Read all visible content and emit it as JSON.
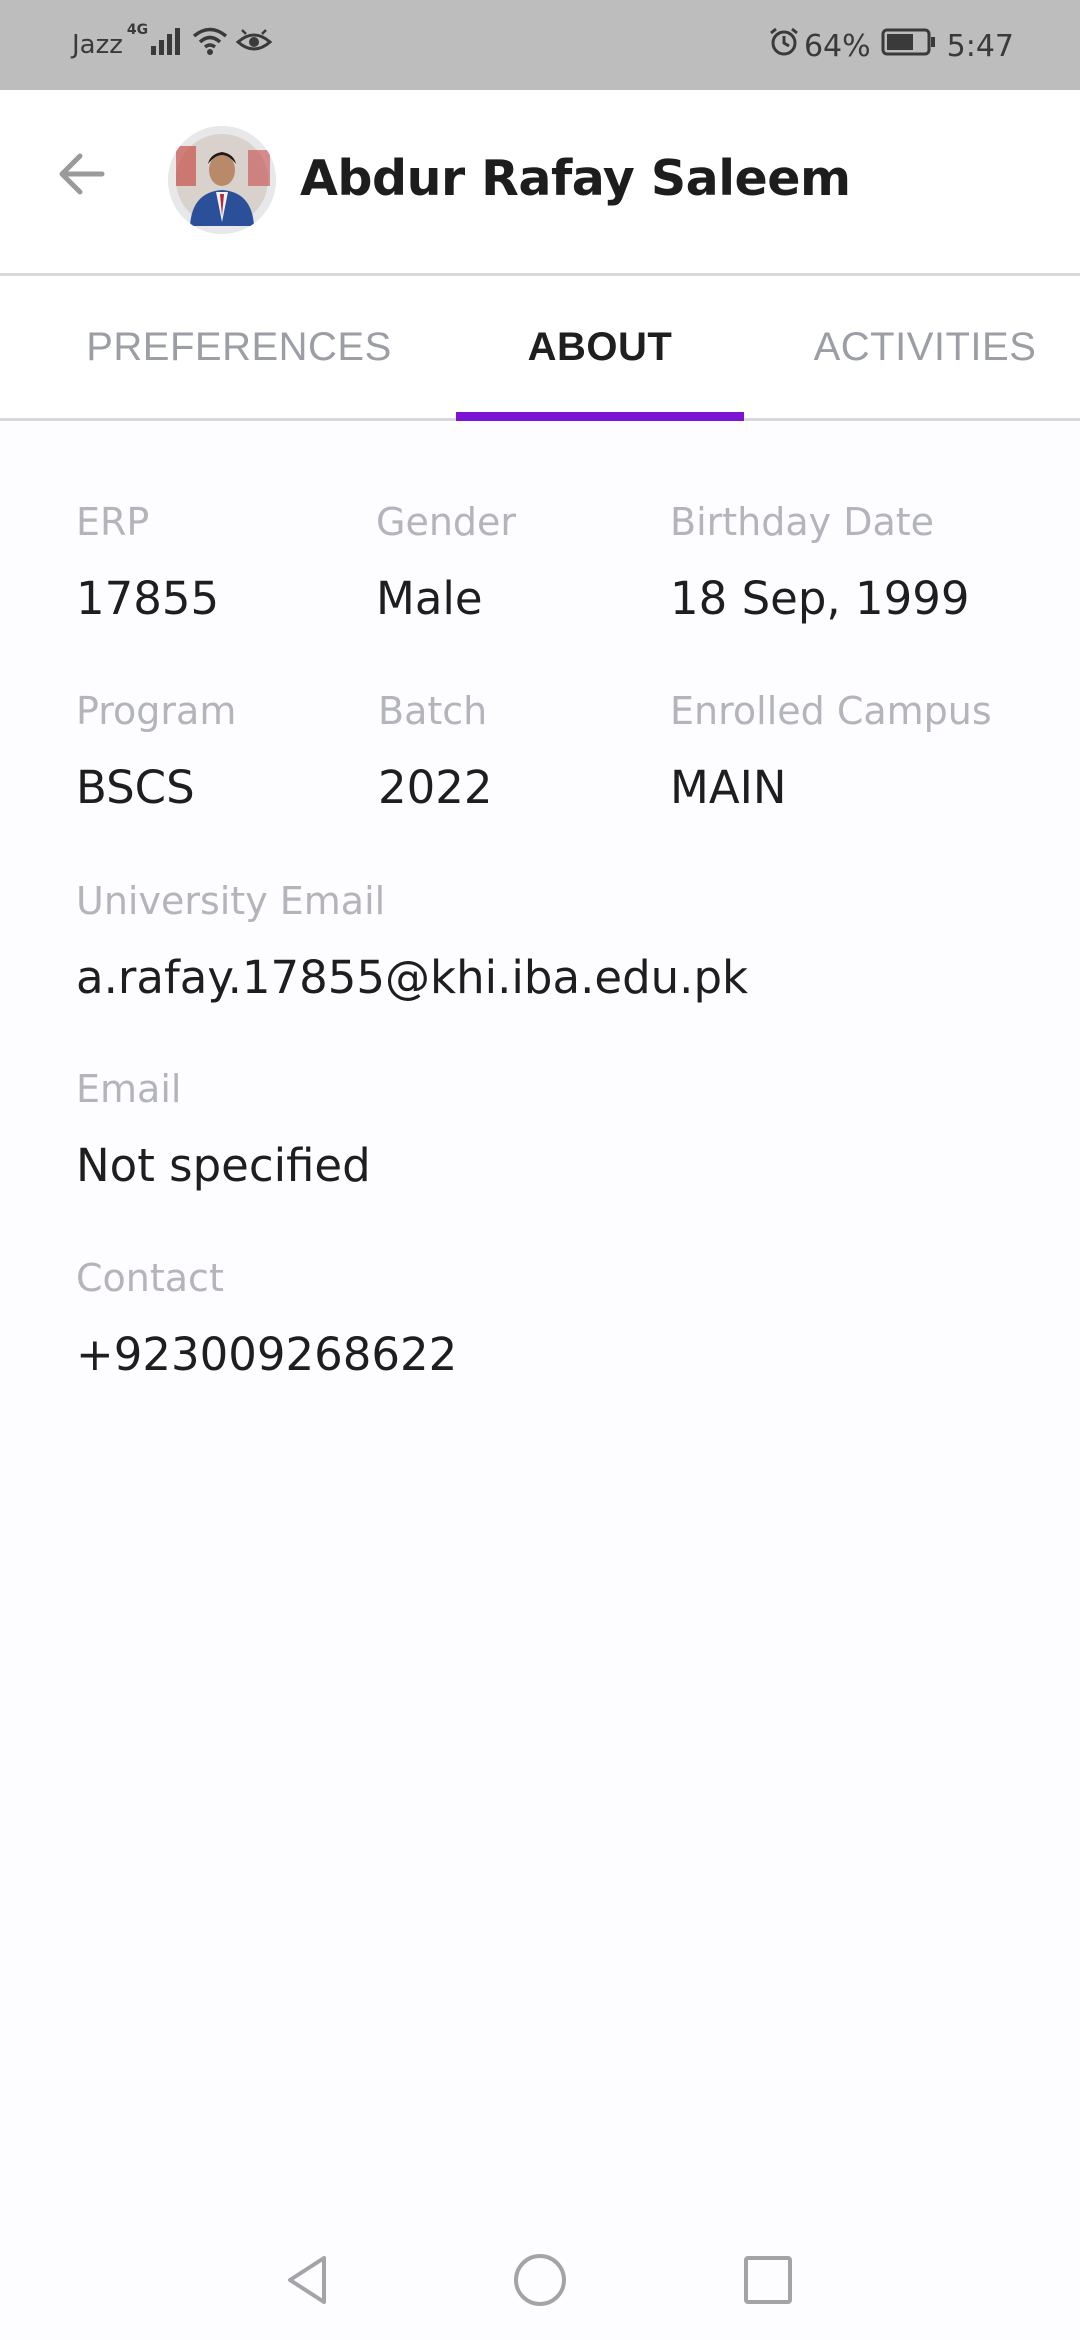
{
  "status_bar": {
    "carrier": "Jazz",
    "network": "4G",
    "battery": "64%",
    "time": "5:47",
    "icons": [
      "signal-icon",
      "wifi-icon",
      "eye-icon",
      "alarm-icon",
      "battery-icon"
    ]
  },
  "header": {
    "name": "Abdur Rafay Saleem",
    "back_icon": "arrow-left-icon",
    "avatar": "profile-avatar"
  },
  "tabs": {
    "items": [
      {
        "label": "PREFERENCES"
      },
      {
        "label": "ABOUT"
      },
      {
        "label": "ACTIVITIES"
      }
    ],
    "active": "ABOUT",
    "accent_color": "#7b14d4"
  },
  "about": {
    "erp": {
      "label": "ERP",
      "value": "17855"
    },
    "gender": {
      "label": "Gender",
      "value": "Male"
    },
    "birthday": {
      "label": "Birthday Date",
      "value": "18 Sep, 1999"
    },
    "program": {
      "label": "Program",
      "value": "BSCS"
    },
    "batch": {
      "label": "Batch",
      "value": "2022"
    },
    "campus": {
      "label": "Enrolled Campus",
      "value": "MAIN"
    },
    "university_email": {
      "label": "University Email",
      "value": "a.rafay.17855@khi.iba.edu.pk"
    },
    "email": {
      "label": "Email",
      "value": "Not specified"
    },
    "contact": {
      "label": "Contact",
      "value": "+923009268622"
    }
  },
  "nav_bar": {
    "icons": [
      "back-triangle-icon",
      "home-circle-icon",
      "recents-square-icon"
    ]
  }
}
